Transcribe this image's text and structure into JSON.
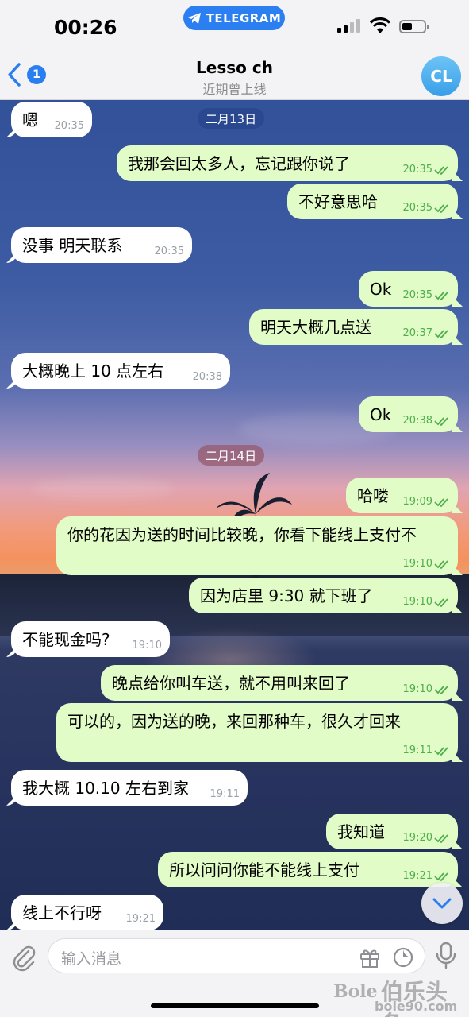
{
  "status_bar": {
    "time": "00:26",
    "telegram_pill": "TELEGRAM"
  },
  "header": {
    "back_badge": "1",
    "name": "Lesso ch",
    "status": "近期曾上线",
    "avatar_initials": "CL"
  },
  "date_separators": [
    "二月13日",
    "二月14日"
  ],
  "messages": [
    {
      "dir": "in",
      "text": "嗯",
      "time": "20:35"
    },
    {
      "dir": "out",
      "text": "我那会回太多人，忘记跟你说了",
      "time": "20:35",
      "read": true
    },
    {
      "dir": "out",
      "text": "不好意思哈",
      "time": "20:35",
      "read": true
    },
    {
      "dir": "in",
      "text": "没事 明天联系",
      "time": "20:35"
    },
    {
      "dir": "out",
      "text": "Ok",
      "time": "20:35",
      "read": true
    },
    {
      "dir": "out",
      "text": "明天大概几点送",
      "time": "20:37",
      "read": true
    },
    {
      "dir": "in",
      "text": "大概晚上 10 点左右",
      "time": "20:38"
    },
    {
      "dir": "out",
      "text": "Ok",
      "time": "20:38",
      "read": true
    },
    {
      "dir": "out",
      "text": "哈喽",
      "time": "19:09",
      "read": true
    },
    {
      "dir": "out",
      "text": "你的花因为送的时间比较晚，你看下能线上支付不",
      "time": "19:10",
      "read": true
    },
    {
      "dir": "out",
      "text": "因为店里 9:30 就下班了",
      "time": "19:10",
      "read": true
    },
    {
      "dir": "in",
      "text": "不能现金吗?",
      "time": "19:10"
    },
    {
      "dir": "out",
      "text": "晚点给你叫车送，就不用叫来回了",
      "time": "19:10",
      "read": true
    },
    {
      "dir": "out",
      "text": "可以的，因为送的晚，来回那种车，很久才回来",
      "time": "19:11",
      "read": true
    },
    {
      "dir": "in",
      "text": "我大概 10.10 左右到家",
      "time": "19:11"
    },
    {
      "dir": "out",
      "text": "我知道",
      "time": "19:20",
      "read": true
    },
    {
      "dir": "out",
      "text": "所以问问你能不能线上支付",
      "time": "19:21",
      "read": true
    },
    {
      "dir": "in",
      "text": "线上不行呀",
      "time": "19:21"
    }
  ],
  "input": {
    "placeholder": "输入消息"
  },
  "watermark": {
    "latin": "Bole",
    "chinese": "伯乐头条",
    "site": "bole90.com"
  },
  "colors": {
    "accent": "#2a7ff0",
    "outgoing_bubble": "#e2fcc7",
    "incoming_bubble": "#ffffff",
    "read_check": "#4fae4e"
  }
}
